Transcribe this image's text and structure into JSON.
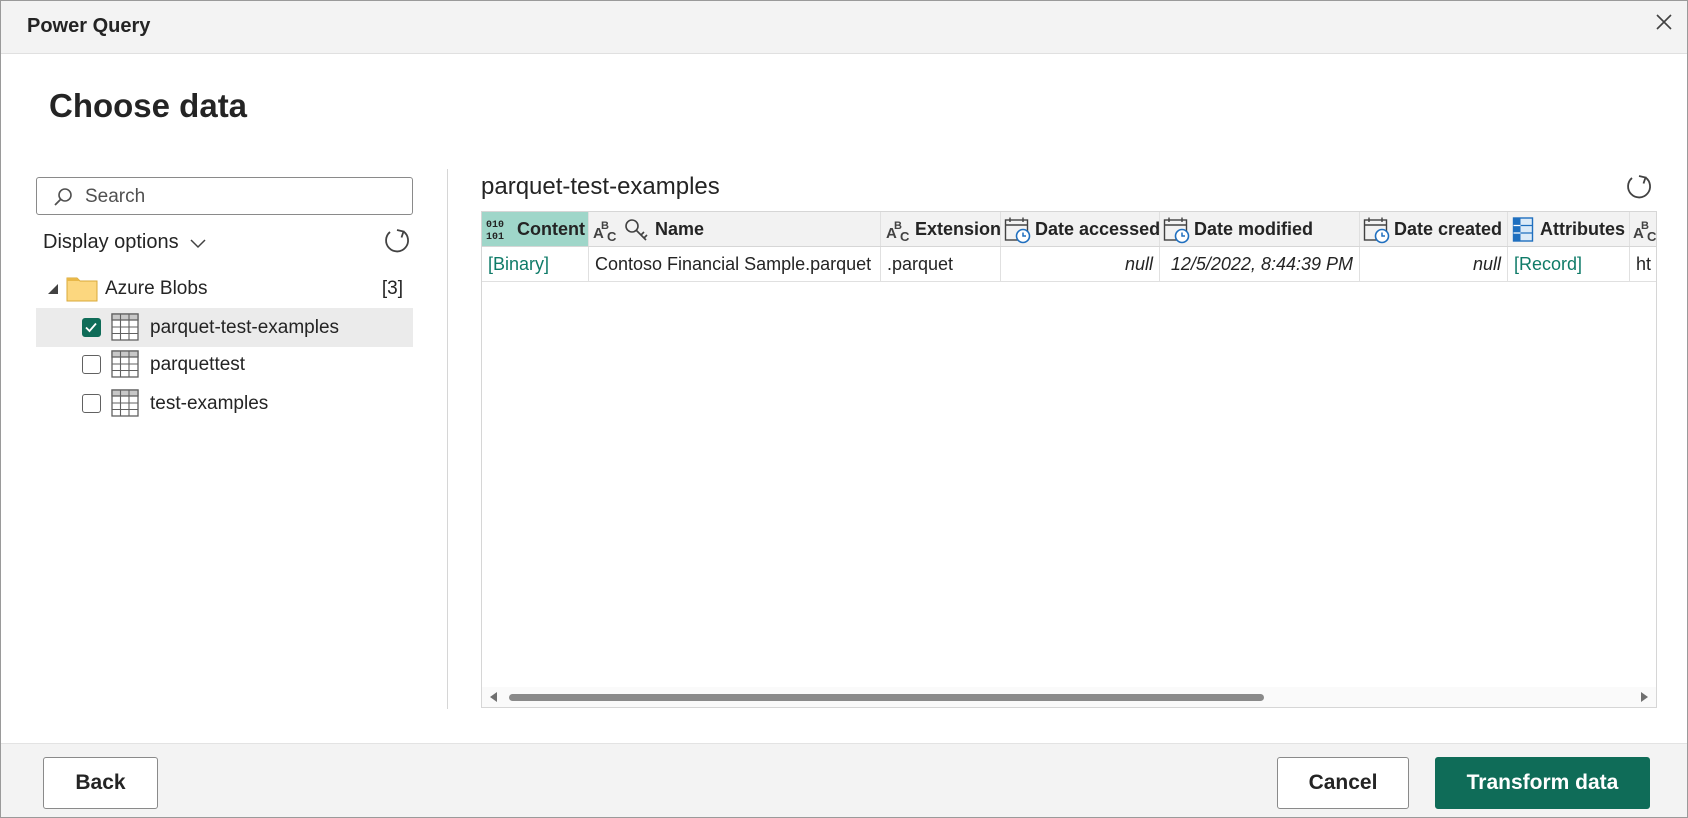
{
  "window": {
    "title": "Power Query",
    "close_icon": "close-icon"
  },
  "page": {
    "heading": "Choose data"
  },
  "navigator": {
    "search": {
      "placeholder": "Search",
      "value": ""
    },
    "display_options_label": "Display options",
    "tree": {
      "root": {
        "label": "Azure Blobs",
        "count": "[3]",
        "expanded": true,
        "icon": "folder-icon"
      },
      "items": [
        {
          "label": "parquet-test-examples",
          "checked": true,
          "selected": true,
          "icon": "table-icon"
        },
        {
          "label": "parquettest",
          "checked": false,
          "selected": false,
          "icon": "table-icon"
        },
        {
          "label": "test-examples",
          "checked": false,
          "selected": false,
          "icon": "table-icon"
        }
      ]
    }
  },
  "preview": {
    "title": "parquet-test-examples",
    "columns": [
      {
        "label": "Content",
        "type_icon": "binary-type-icon"
      },
      {
        "label": "Name",
        "type_icon": "text-key-type-icon"
      },
      {
        "label": "Extension",
        "type_icon": "text-type-icon"
      },
      {
        "label": "Date accessed",
        "type_icon": "datetime-type-icon"
      },
      {
        "label": "Date modified",
        "type_icon": "datetime-type-icon"
      },
      {
        "label": "Date created",
        "type_icon": "datetime-type-icon"
      },
      {
        "label": "Attributes",
        "type_icon": "record-type-icon"
      },
      {
        "label": "",
        "type_icon": "text-type-icon"
      }
    ],
    "rows": [
      [
        "[Binary]",
        "Contoso Financial Sample.parquet",
        ".parquet",
        "null",
        "12/5/2022, 8:44:39 PM",
        "null",
        "[Record]",
        "ht"
      ]
    ]
  },
  "footer": {
    "back_label": "Back",
    "cancel_label": "Cancel",
    "transform_label": "Transform data"
  },
  "colors": {
    "accent": "#0f6c58",
    "active_header": "#9fd6c9",
    "link": "#0f7b68"
  }
}
